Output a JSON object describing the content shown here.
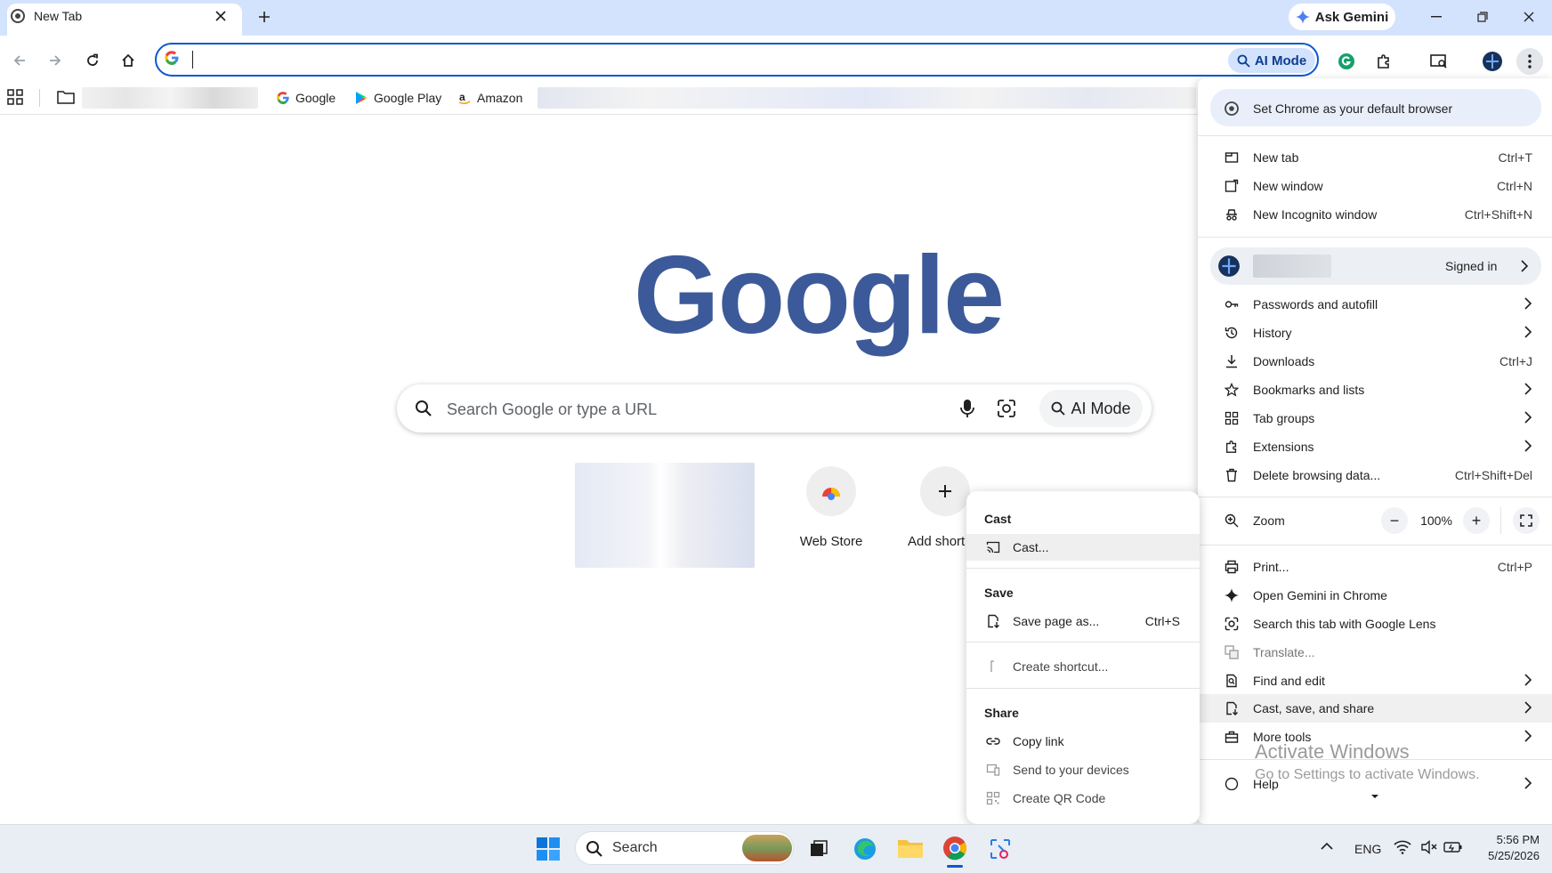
{
  "tab": {
    "title": "New Tab",
    "close_icon": "close-icon",
    "new_tab_icon": "plus-icon"
  },
  "titlebar": {
    "gemini_label": "Ask Gemini"
  },
  "omnibox": {
    "value": "",
    "ai_mode_label": "AI Mode"
  },
  "bookmarks": [
    {
      "label": "Google",
      "icon": "google-g-icon"
    },
    {
      "label": "Google Play",
      "icon": "google-play-icon"
    },
    {
      "label": "Amazon",
      "icon": "amazon-icon"
    }
  ],
  "ntp": {
    "logo": "Google",
    "search_placeholder": "Search Google or type a URL",
    "ai_mode_label": "AI Mode",
    "shortcuts": [
      {
        "label": "Web Store"
      },
      {
        "label": "Add short"
      }
    ]
  },
  "chrome_menu": {
    "default_browser": "Set Chrome as your default browser",
    "new_tab": {
      "label": "New tab",
      "shortcut": "Ctrl+T"
    },
    "new_window": {
      "label": "New window",
      "shortcut": "Ctrl+N"
    },
    "incognito": {
      "label": "New Incognito window",
      "shortcut": "Ctrl+Shift+N"
    },
    "profile_status": "Signed in",
    "passwords": "Passwords and autofill",
    "history": "History",
    "downloads": {
      "label": "Downloads",
      "shortcut": "Ctrl+J"
    },
    "bookmarks": "Bookmarks and lists",
    "tab_groups": "Tab groups",
    "extensions": "Extensions",
    "delete_data": {
      "label": "Delete browsing data...",
      "shortcut": "Ctrl+Shift+Del"
    },
    "zoom": {
      "label": "Zoom",
      "value": "100%",
      "minus": "−",
      "plus": "+"
    },
    "print": {
      "label": "Print...",
      "shortcut": "Ctrl+P"
    },
    "gemini": "Open Gemini in Chrome",
    "lens": "Search this tab with Google Lens",
    "translate": "Translate...",
    "find_edit": "Find and edit",
    "cast_save_share": "Cast, save, and share",
    "more_tools": "More tools",
    "help": "Help"
  },
  "submenu": {
    "cast_header": "Cast",
    "cast_item": "Cast...",
    "save_header": "Save",
    "save_page": {
      "label": "Save page as...",
      "shortcut": "Ctrl+S"
    },
    "create_shortcut": "Create shortcut...",
    "share_header": "Share",
    "copy_link": "Copy link",
    "send_devices": "Send to your devices",
    "qr_code": "Create QR Code"
  },
  "watermark": {
    "line1": "Activate Windows",
    "line2": "Go to Settings to activate Windows."
  },
  "taskbar": {
    "search_label": "Search",
    "language": "ENG",
    "time": "5:56 PM",
    "date": "5/25/2026"
  },
  "colors": {
    "accent": "#0b57d0",
    "tabstrip": "#d3e3fd",
    "logo": "#3c5a9a"
  }
}
